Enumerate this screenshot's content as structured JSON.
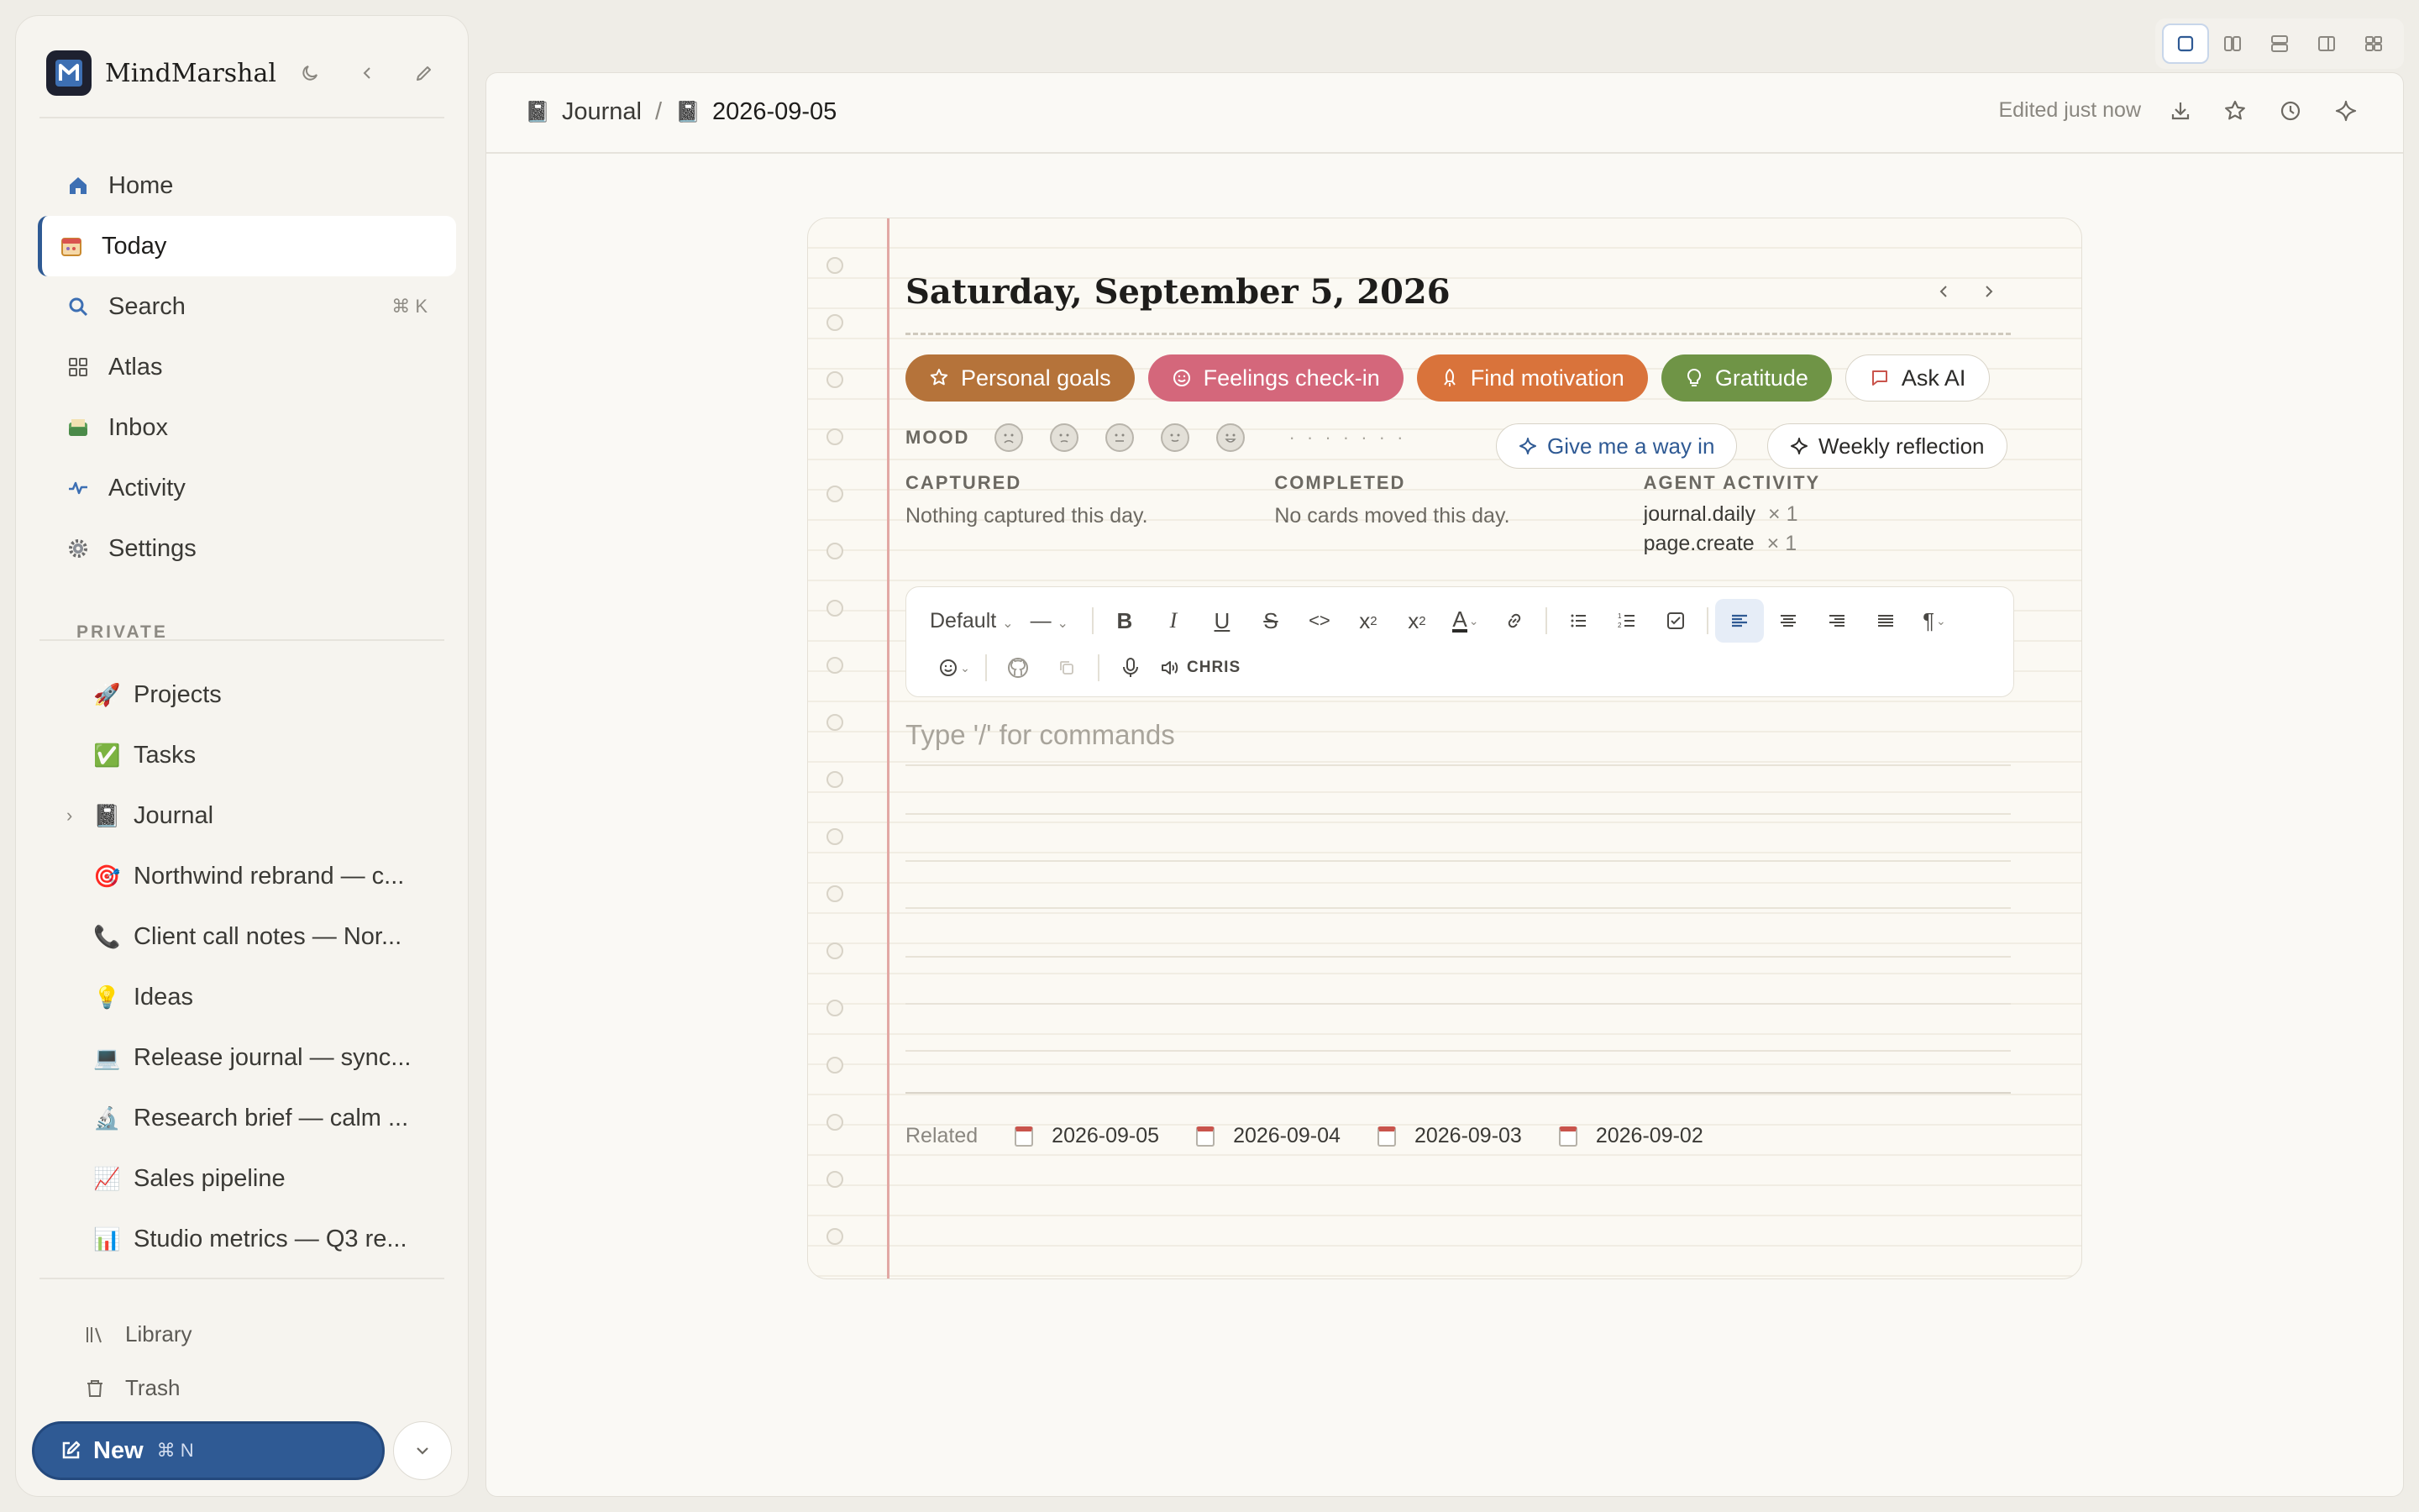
{
  "app": {
    "name": "MindMarshal"
  },
  "sidebar": {
    "nav": [
      {
        "label": "Home",
        "icon": "home-icon"
      },
      {
        "label": "Today",
        "icon": "calendar-icon",
        "active": true
      },
      {
        "label": "Search",
        "icon": "search-icon",
        "shortcut": "⌘ K"
      },
      {
        "label": "Atlas",
        "icon": "grid-icon"
      },
      {
        "label": "Inbox",
        "icon": "inbox-icon"
      },
      {
        "label": "Activity",
        "icon": "activity-icon"
      },
      {
        "label": "Settings",
        "icon": "gear-icon"
      }
    ],
    "section_label": "PRIVATE",
    "pages": [
      {
        "emoji": "🚀",
        "label": "Projects"
      },
      {
        "emoji": "✅",
        "label": "Tasks"
      },
      {
        "emoji": "📓",
        "label": "Journal",
        "expandable": true
      },
      {
        "emoji": "🎯",
        "label": "Northwind rebrand — c..."
      },
      {
        "emoji": "📞",
        "label": "Client call notes — Nor..."
      },
      {
        "emoji": "💡",
        "label": "Ideas"
      },
      {
        "emoji": "💻",
        "label": "Release journal — sync..."
      },
      {
        "emoji": "🔬",
        "label": "Research brief — calm ..."
      },
      {
        "emoji": "📈",
        "label": "Sales pipeline"
      },
      {
        "emoji": "📊",
        "label": "Studio metrics — Q3 re..."
      }
    ],
    "footer": [
      {
        "label": "Library",
        "icon": "library-icon"
      },
      {
        "label": "Trash",
        "icon": "trash-icon"
      }
    ],
    "new_button": {
      "label": "New",
      "shortcut": "⌘ N"
    }
  },
  "header": {
    "breadcrumb": [
      {
        "emoji": "📓",
        "label": "Journal"
      },
      {
        "emoji": "📓",
        "label": "2026-09-05"
      }
    ],
    "separator": "/",
    "edited": "Edited just now"
  },
  "journal": {
    "date_title": "Saturday, September 5, 2026",
    "chips": [
      {
        "label": "Personal goals",
        "color": "#b5733a",
        "icon": "star-icon"
      },
      {
        "label": "Feelings check-in",
        "color": "#d4677b",
        "icon": "smile-icon"
      },
      {
        "label": "Find motivation",
        "color": "#d9733b",
        "icon": "rocket-icon"
      },
      {
        "label": "Gratitude",
        "color": "#6f9446",
        "icon": "bulb-icon"
      },
      {
        "label": "Ask AI",
        "color": "#ffffff",
        "icon": "chat-icon"
      }
    ],
    "mood_label": "MOOD",
    "mood_dots": "· · · · · · ·",
    "give_way_in": "Give me a way in",
    "weekly_reflection": "Weekly reflection",
    "stats": {
      "captured": {
        "heading": "CAPTURED",
        "value": "Nothing captured this day."
      },
      "completed": {
        "heading": "COMPLETED",
        "value": "No cards moved this day."
      },
      "agent": {
        "heading": "AGENT ACTIVITY",
        "lines": [
          {
            "name": "journal.daily",
            "count": "× 1"
          },
          {
            "name": "page.create",
            "count": "× 1"
          }
        ]
      }
    },
    "toolbar": {
      "style_select": "Default",
      "dash_select": "—",
      "speaker_label": "CHRIS"
    },
    "placeholder": "Type '/' for commands",
    "related_label": "Related",
    "related": [
      "2026-09-05",
      "2026-09-04",
      "2026-09-03",
      "2026-09-02"
    ]
  },
  "colors": {
    "accent": "#2f5a94",
    "margin_line": "#e2a8a4"
  }
}
